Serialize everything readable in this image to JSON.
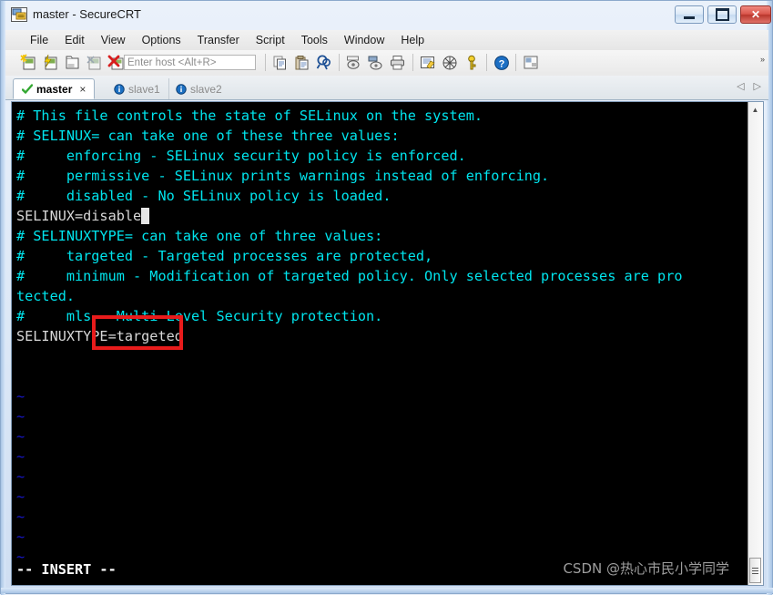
{
  "window": {
    "title": "master - SecureCRT",
    "icon": "securecrt-app-icon",
    "controls": {
      "minimize": "Minimize",
      "maximize": "Maximize",
      "close": "Close"
    }
  },
  "menu": {
    "items": [
      "File",
      "Edit",
      "View",
      "Options",
      "Transfer",
      "Script",
      "Tools",
      "Window",
      "Help"
    ]
  },
  "toolbar": {
    "host_placeholder": "Enter host <Alt+R>",
    "host_value": "",
    "overflow_label": "»",
    "icons": [
      "new-session-icon",
      "quick-connect-icon",
      "new-tab-icon",
      "clone-session-icon",
      "disconnect-icon",
      "copy-icon",
      "paste-icon",
      "find-icon",
      "log-session-icon",
      "print-screen-icon",
      "print-icon",
      "session-options-icon",
      "global-options-icon",
      "key-icon",
      "help-icon",
      "session-manager-icon"
    ]
  },
  "tabs": {
    "items": [
      {
        "label": "master",
        "state": "active",
        "icon": "green-check-icon",
        "closable": true,
        "close_label": "×"
      },
      {
        "label": "slave1",
        "state": "inactive",
        "icon": "info-circle-icon",
        "closable": false,
        "close_label": ""
      },
      {
        "label": "slave2",
        "state": "inactive",
        "icon": "info-circle-icon",
        "closable": false,
        "close_label": ""
      }
    ],
    "scroll_left": "◁",
    "scroll_right": "▷"
  },
  "terminal": {
    "lines": [
      {
        "text": "# This file controls the state of SELinux on the system.",
        "color": "cyan"
      },
      {
        "text": "# SELINUX= can take one of these three values:",
        "color": "cyan"
      },
      {
        "text": "#     enforcing - SELinux security policy is enforced.",
        "color": "cyan"
      },
      {
        "text": "#     permissive - SELinux prints warnings instead of enforcing.",
        "color": "cyan"
      },
      {
        "text": "#     disabled - No SELinux policy is loaded.",
        "color": "cyan"
      },
      {
        "text": "SELINUX=disable",
        "color": "white",
        "cursor": true
      },
      {
        "text": "# SELINUXTYPE= can take one of three values:",
        "color": "cyan"
      },
      {
        "text": "#     targeted - Targeted processes are protected,",
        "color": "cyan"
      },
      {
        "text": "#     minimum - Modification of targeted policy. Only selected processes are pro",
        "color": "cyan"
      },
      {
        "text": "tected.",
        "color": "cyan"
      },
      {
        "text": "#     mls - Multi Level Security protection.",
        "color": "cyan"
      },
      {
        "text": "SELINUXTYPE=targeted",
        "color": "white"
      },
      {
        "text": "",
        "color": "cyan"
      },
      {
        "text": "",
        "color": "cyan"
      },
      {
        "text": "~",
        "color": "blue"
      },
      {
        "text": "~",
        "color": "blue"
      },
      {
        "text": "~",
        "color": "blue"
      },
      {
        "text": "~",
        "color": "blue"
      },
      {
        "text": "~",
        "color": "blue"
      },
      {
        "text": "~",
        "color": "blue"
      },
      {
        "text": "~",
        "color": "blue"
      },
      {
        "text": "~",
        "color": "blue"
      },
      {
        "text": "~",
        "color": "blue"
      }
    ],
    "status_line": "-- INSERT --",
    "watermark": "CSDN @热心市民小学同学",
    "highlight_box_color": "#e81b1b",
    "scrollbar": {
      "up_arrow": "▲"
    }
  }
}
